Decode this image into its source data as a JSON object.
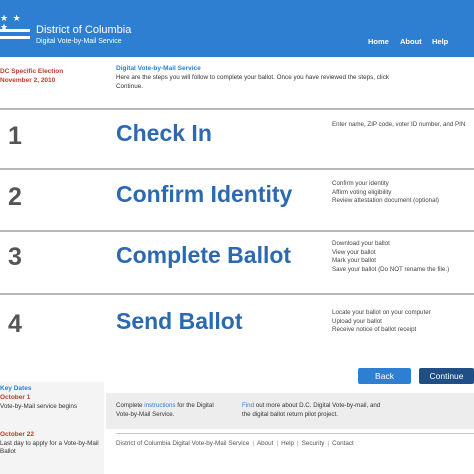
{
  "header": {
    "title": "District of Columbia",
    "subtitle": "Digital Vote-by-Mail Service",
    "stars": "★ ★ ★",
    "nav": [
      {
        "label": "Home"
      },
      {
        "label": "About"
      },
      {
        "label": "Help"
      }
    ]
  },
  "sidebar": {
    "election": "DC Specific Election",
    "election_date": "November 2, 2010",
    "key_dates_title": "Key Dates",
    "dates": [
      {
        "date": "October 1",
        "text": "Vote-by-Mail service begins"
      },
      {
        "date": "October 22",
        "text": "Last day to apply for a Vote-by-Mail Ballot"
      }
    ]
  },
  "intro": {
    "title": "Digital Vote-by-Mail Service",
    "text": "Here are the steps you will follow to complete your ballot. Once you have reviewed the steps, click Continue."
  },
  "steps": [
    {
      "number": "1",
      "title": "Check In",
      "details": [
        "Enter name, ZIP code, voter ID number, and PIN"
      ]
    },
    {
      "number": "2",
      "title": "Confirm Identity",
      "details": [
        "Confirm your identity",
        "Affirm voting eligibility",
        "Review attestation document (optional)"
      ]
    },
    {
      "number": "3",
      "title": "Complete Ballot",
      "details": [
        "Download your ballot",
        "View your ballot",
        "Mark your ballot",
        "Save your ballot (Do NOT rename the file.)"
      ]
    },
    {
      "number": "4",
      "title": "Send Ballot",
      "details": [
        "Locate your ballot on your computer",
        "Upload your ballot",
        "Receive notice of ballot receipt"
      ]
    }
  ],
  "buttons": {
    "back": "Back",
    "continue": "Continue"
  },
  "info": {
    "col1_prefix": "Complete",
    "col1_link": "instructions",
    "col1_suffix": "for the Digital",
    "col1_line2": "Vote-by-Mail Service.",
    "col2_link": "Find",
    "col2_suffix": "out more about D.C. Digital Vote-by-mail, and",
    "col2_line2": "the digital ballot return pilot project."
  },
  "footer": {
    "copyright": "District of Columbia Digital Vote-by-Mail Service",
    "links": [
      "About",
      "Help",
      "Security",
      "Contact"
    ]
  },
  "colors": {
    "header_bg": "#2e7fd1",
    "step_title": "#2b69b0",
    "accent_red": "#c0392b",
    "continue_button": "#1f4f86"
  }
}
